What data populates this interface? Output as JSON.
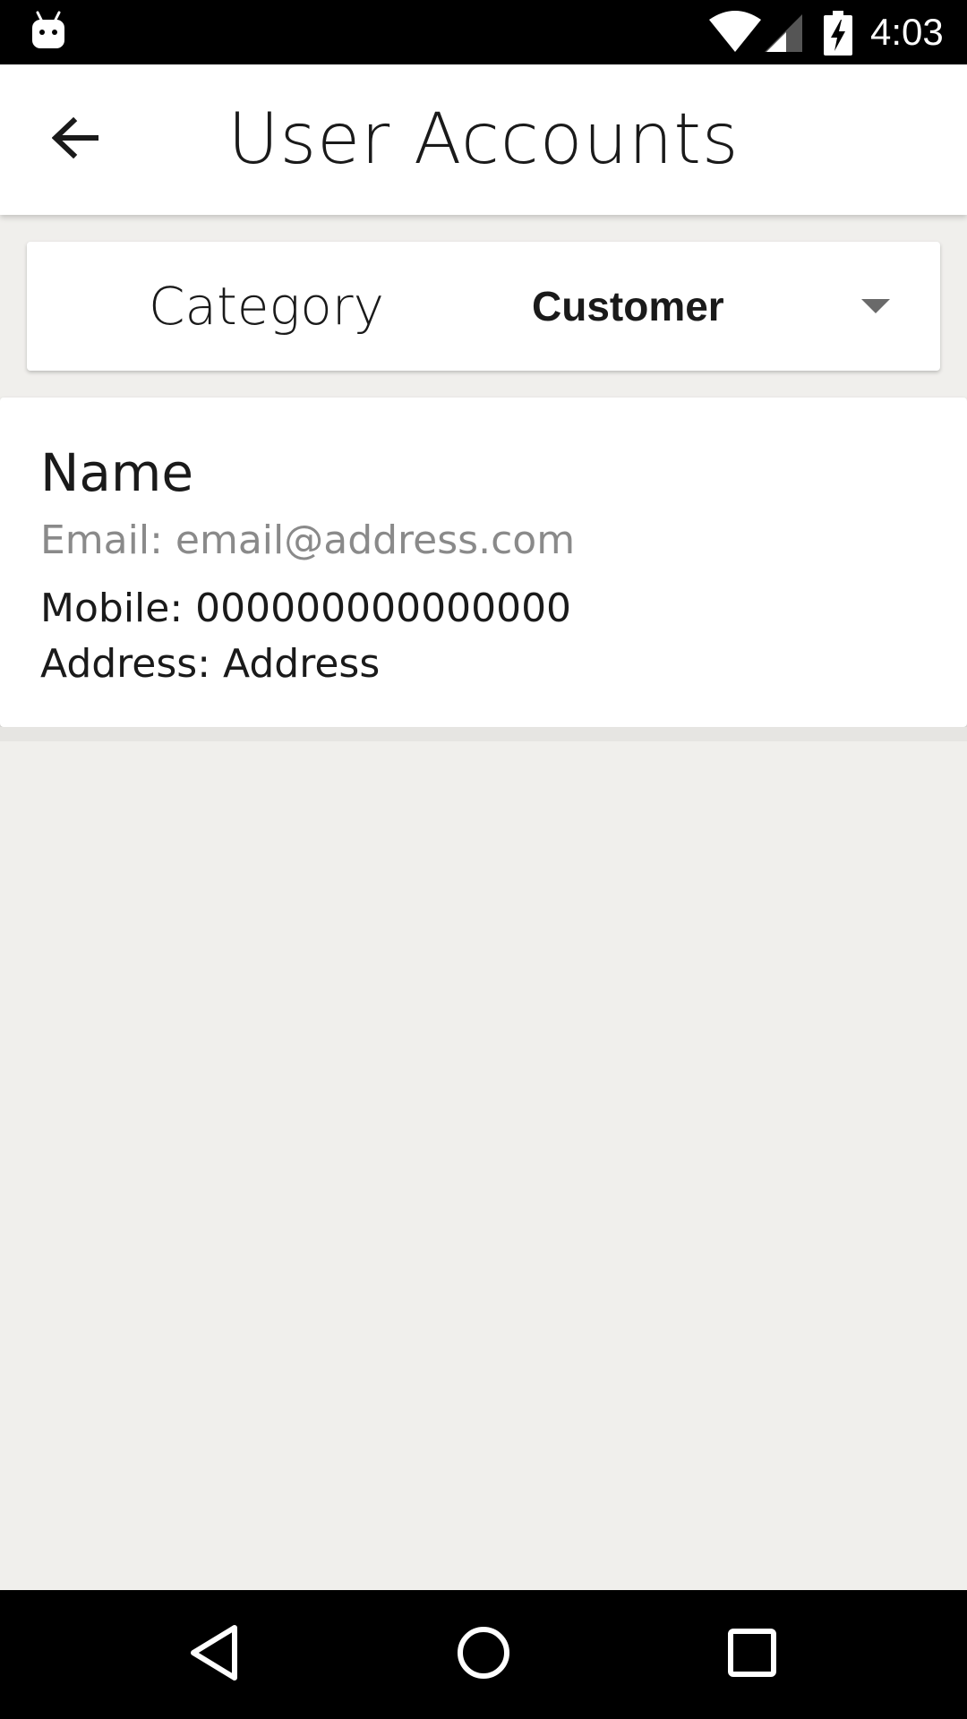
{
  "status_bar": {
    "time": "4:03",
    "icons": [
      "android-notification-icon",
      "wifi-icon",
      "signal-icon",
      "battery-charging-icon"
    ]
  },
  "app_bar": {
    "title": "User Accounts",
    "back_icon": "arrow-back-icon"
  },
  "filter": {
    "label": "Category",
    "selected": "Customer",
    "dropdown_icon": "caret-down-icon"
  },
  "users": [
    {
      "name": "Name",
      "email": "Email: email@address.com",
      "mobile": "Mobile: 000000000000000",
      "address": "Address: Address"
    }
  ],
  "nav_bar": {
    "icons": [
      "nav-back-icon",
      "nav-home-icon",
      "nav-recents-icon"
    ]
  },
  "colors": {
    "background": "#f0efec",
    "card": "#ffffff",
    "primary_text": "#1a1a1a",
    "secondary_text": "#8a8a8a",
    "system_bars": "#000000"
  }
}
